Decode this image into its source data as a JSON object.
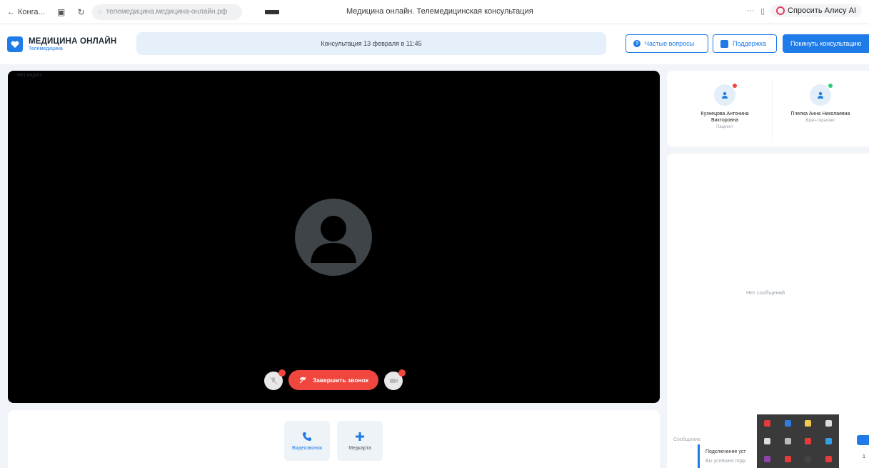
{
  "browser": {
    "back_label": "Конга...",
    "url": "телемедицина.медицина-онлайн.рф",
    "tab_title": "Медицина онлайн. Телемедицинская консультация",
    "more": "···",
    "ask_alice": "Спросить Алису AI"
  },
  "header": {
    "logo_title": "МЕДИЦИНА ОНЛАЙН",
    "logo_subtitle": "Телемедицина",
    "consultation": "Консультация 13 февраля в 11:45",
    "faq_label": "Частые вопросы",
    "support_label": "Поддержка",
    "leave_label": "Покинуть консультацию"
  },
  "video": {
    "label": "Нет видео",
    "end_call_label": "Завершить звонок"
  },
  "toolbar": {
    "videocall_label": "Видеозвонок",
    "medcards_label": "Медкарта"
  },
  "participants": [
    {
      "name_line1": "Кузнецова Антонина",
      "name_line2": "Викторовна",
      "role": "Пациент",
      "status_color": "#f0463e"
    },
    {
      "name_line1": "Пчелка Анна Николаевна",
      "name_line2": "",
      "role": "Врач-терапевт",
      "status_color": "#2ecc71"
    }
  ],
  "chat": {
    "empty_label": "Нет сообщений",
    "input_label": "Сообщение",
    "notification_title": "Подключение уст",
    "notification_sub": "Вы успешно подк",
    "count": "1"
  },
  "colors": {
    "accent": "#1e7be8",
    "danger": "#f0463e"
  },
  "tray_icons": [
    {
      "name": "opera-icon",
      "color": "#e63b3b"
    },
    {
      "name": "bluetooth-icon",
      "color": "#2f7de1"
    },
    {
      "name": "app-icon",
      "color": "#f2c94c"
    },
    {
      "name": "pen-icon",
      "color": "#dddddd"
    },
    {
      "name": "telegram-icon",
      "color": "#dddddd"
    },
    {
      "name": "window-icon",
      "color": "#bbbbbb"
    },
    {
      "name": "record-icon",
      "color": "#e63b3b"
    },
    {
      "name": "check-icon",
      "color": "#35a0e8"
    },
    {
      "name": "brush-icon",
      "color": "#8e44ad"
    },
    {
      "name": "doc-icon",
      "color": "#e63b3b"
    },
    {
      "name": "pencil-icon",
      "color": "#444444"
    },
    {
      "name": "yandex-icon",
      "color": "#e63b3b"
    }
  ]
}
